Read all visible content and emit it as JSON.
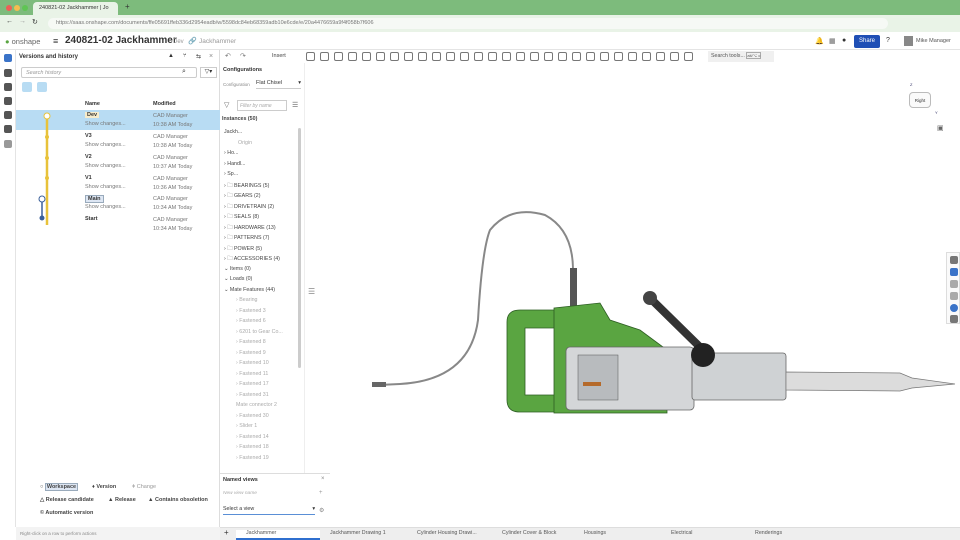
{
  "browser": {
    "tab_title": "240821-02 Jackhammer | Jo",
    "url": "https://saas.onshape.com/documents/ffe05691ffeb336d2954eadb/w/5598dc84eb68359adb10e6cde/e/20a4476659a9f4f058b7f606"
  },
  "header": {
    "logo": "onshape",
    "doc_title": "240821-02 Jackhammer",
    "branch": "Dev",
    "part_studio": "Jackhammer",
    "share": "Share",
    "user": "Mike Manager"
  },
  "toolbar": {
    "insert": "Insert",
    "search_tools": "Search tools...",
    "shortcut": "alt/⌥ c"
  },
  "versions": {
    "title": "Versions and history",
    "search_placeholder": "Search history",
    "col_name": "Name",
    "col_modified": "Modified",
    "rows": [
      {
        "name": "Dev",
        "show": "Show changes...",
        "by": "CAD Manager",
        "time": "10:38 AM Today"
      },
      {
        "name": "V3",
        "show": "Show changes...",
        "by": "CAD Manager",
        "time": "10:38 AM Today"
      },
      {
        "name": "V2",
        "show": "Show changes...",
        "by": "CAD Manager",
        "time": "10:37 AM Today"
      },
      {
        "name": "V1",
        "show": "Show changes...",
        "by": "CAD Manager",
        "time": "10:36 AM Today"
      },
      {
        "name": "Main",
        "show": "Show changes...",
        "by": "CAD Manager",
        "time": "10:34 AM Today"
      },
      {
        "name": "Start",
        "show": "",
        "by": "CAD Manager",
        "time": "10:34 AM Today"
      }
    ],
    "legend": {
      "workspace": "Workspace",
      "version": "Version",
      "change": "Change",
      "release_candidate": "Release candidate",
      "release": "Release",
      "obsoletion": "Contains obsoletion",
      "auto": "Automatic version"
    },
    "status": "Right-click on a row to perform actions"
  },
  "config": {
    "title": "Configurations",
    "label": "Configuration",
    "value": "Flat Chisel",
    "filter_placeholder": "Filter by name",
    "instances": "Instances (50)",
    "tree": [
      "Jackh...",
      "Origin",
      "Ho...",
      "Handl...",
      "Sp...",
      "BEARINGS (5)",
      "GEARS (2)",
      "DRIVETRAIN (2)",
      "SEALS (8)",
      "HARDWARE (13)",
      "PATTERNS (7)",
      "POWER (5)",
      "ACCESSORIES (4)",
      "Items (0)",
      "Loads (0)",
      "Mate Features (44)",
      "Bearing",
      "Fastened 3",
      "Fastened 6",
      "6201 to Gear Co...",
      "Fastened 8",
      "Fastened 9",
      "Fastened 10",
      "Fastened 11",
      "Fastened 17",
      "Fastened 31",
      "Mate connector 2",
      "Fastened 30",
      "Slider 1",
      "Fastened 14",
      "Fastened 18",
      "Fastened 19"
    ]
  },
  "named_views": {
    "title": "Named views",
    "placeholder": "New view name",
    "select": "Select a view"
  },
  "viewcube": {
    "face": "Right",
    "z": "Z",
    "y": "Y"
  },
  "tabs": [
    "Jackhammer",
    "Jackhammer Drawing 1",
    "Cylinder Housing Drawi...",
    "Cylinder Cover & Block",
    "Housings",
    "Electrical",
    "Renderings"
  ],
  "colors": {
    "accent": "#1f4fb5",
    "selected": "#b8dcf3",
    "branch": "#e8c23a",
    "body": "#5aa541"
  }
}
